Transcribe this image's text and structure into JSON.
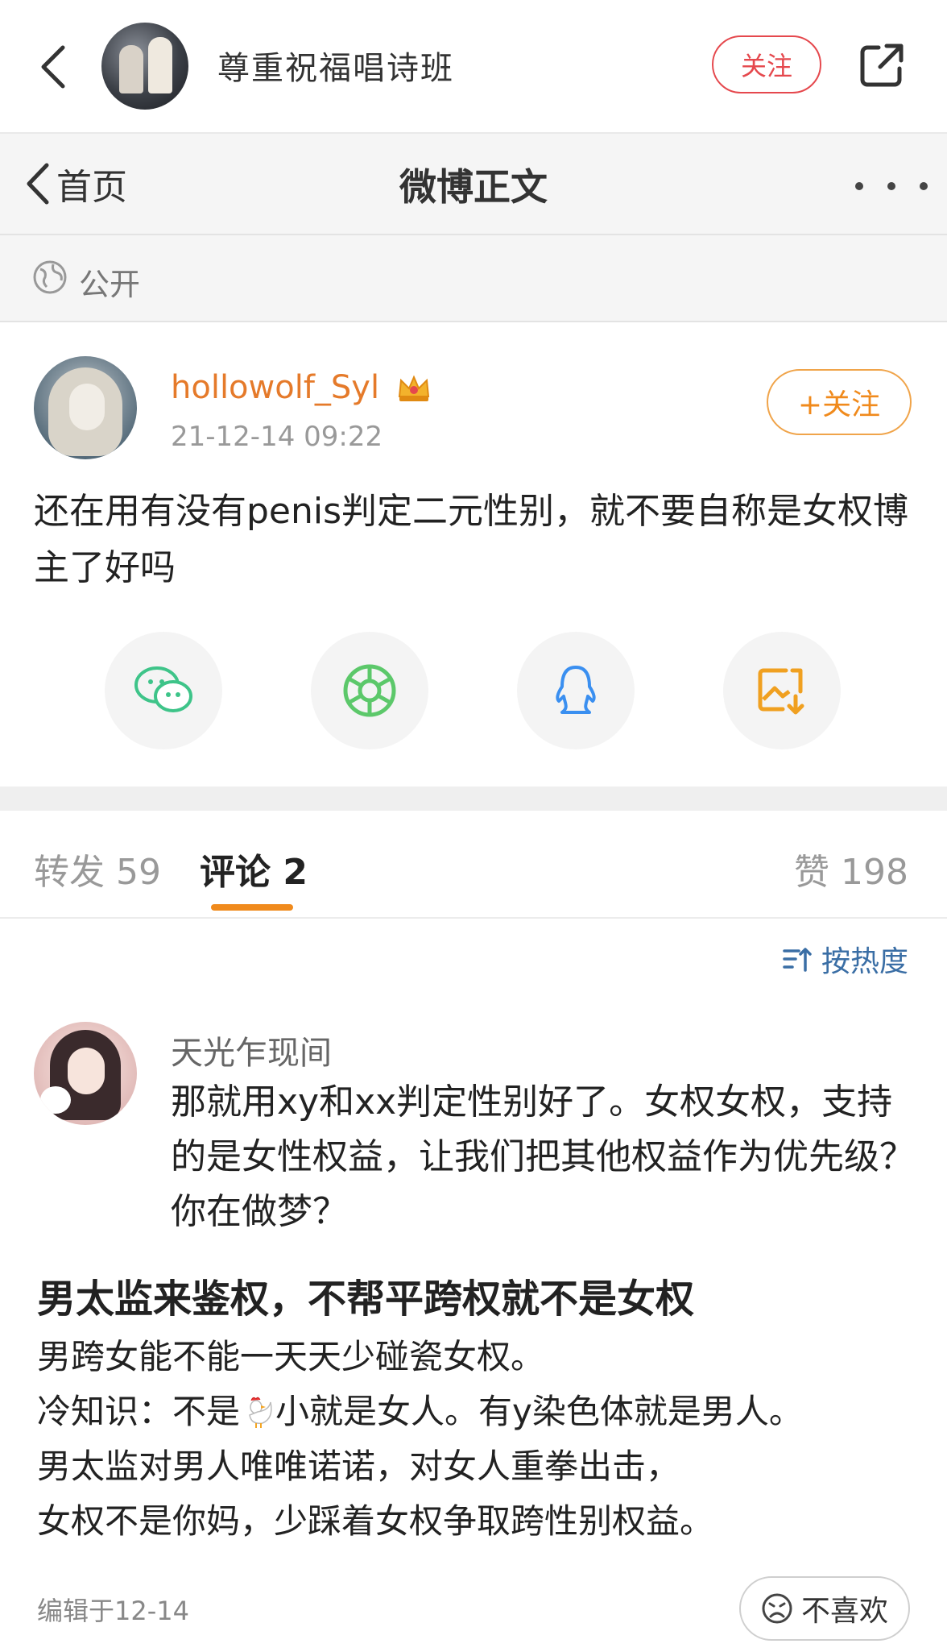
{
  "header": {
    "account_name": "尊重祝福唱诗班",
    "follow_label": "关注"
  },
  "nav": {
    "back_label": "首页",
    "title": "微博正文"
  },
  "visibility": {
    "label": "公开"
  },
  "post": {
    "author": "hollowolf_Syl",
    "timestamp": "21-12-14 09:22",
    "follow_label": "+关注",
    "text": "还在用有没有penis判定二元性别，就不要自称是女权博主了好吗",
    "share_icons": [
      "wechat-icon",
      "moments-icon",
      "qq-icon",
      "save-image-icon"
    ]
  },
  "tabs": {
    "repost": "转发 59",
    "comments": "评论 2",
    "likes": "赞 198"
  },
  "sort": {
    "label": "按热度"
  },
  "comment": {
    "author": "天光乍现间",
    "text": "那就用xy和xx判定性别好了。女权女权，支持的是女性权益，让我们把其他权益作为优先级？你在做梦？"
  },
  "article": {
    "title": "男太监来鉴权，不帮平跨权就不是女权",
    "line1": "男跨女能不能一天天少碰瓷女权。",
    "line2_pre": "冷知识：不是",
    "line2_post": "小就是女人。有y染色体就是男人。",
    "line3": "男太监对男人唯唯诺诺，对女人重拳出击，",
    "line4": "女权不是你妈，少踩着女权争取跨性别权益。",
    "edited": "编辑于12-14",
    "dislike_label": "不喜欢"
  },
  "colors": {
    "accent_orange": "#f08a1c",
    "follow_red": "#e5484d",
    "link_blue": "#3a6ea5"
  }
}
